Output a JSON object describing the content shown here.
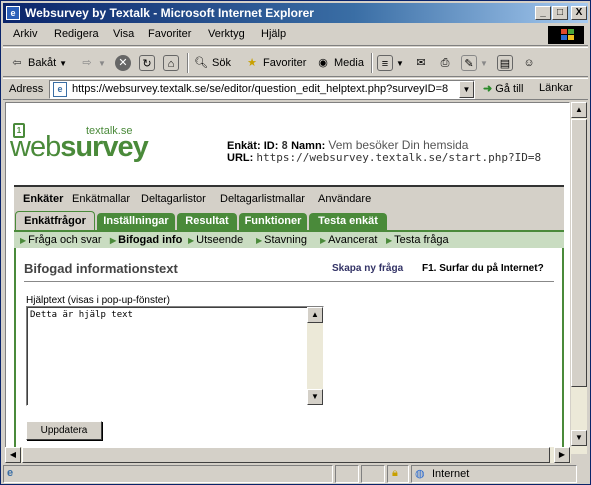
{
  "window": {
    "title": "Websurvey by Textalk - Microsoft Internet Explorer",
    "minimize": "_",
    "maximize": "□",
    "close": "X"
  },
  "menu": [
    "Arkiv",
    "Redigera",
    "Visa",
    "Favoriter",
    "Verktyg",
    "Hjälp"
  ],
  "toolbar": {
    "back": "Bakåt",
    "search": "Sök",
    "favorites": "Favoriter",
    "media": "Media"
  },
  "address": {
    "label": "Adress",
    "url": "https://websurvey.textalk.se/se/editor/question_edit_helptext.php?surveyID=8",
    "go": "Gå till",
    "links": "Länkar"
  },
  "logo": {
    "small": "textalk.se",
    "web": "web",
    "survey": "survey",
    "box": "1"
  },
  "survey_info": {
    "enkat_label": "Enkät:",
    "id_label": "ID:",
    "id": "8",
    "name_label": "Namn:",
    "name": "Vem besöker Din hemsida",
    "url_label": "URL:",
    "url": "https://websurvey.textalk.se/start.php?ID=8"
  },
  "nav": [
    "Enkäter",
    "Enkätmallar",
    "Deltagarlistor",
    "Deltagarlistmallar",
    "Användare"
  ],
  "tabs": [
    "Enkätfrågor",
    "Inställningar",
    "Resultat",
    "Funktioner",
    "Testa enkät"
  ],
  "subnav": [
    "Fråga och svar",
    "Bifogad info",
    "Utseende",
    "Stavning",
    "Avancerat",
    "Testa fråga"
  ],
  "panel": {
    "title": "Bifogad informationstext",
    "new_question": "Skapa ny fråga",
    "question": "F1. Surfar du på Internet?",
    "help_label": "Hjälptext (visas i pop-up-fönster)",
    "help_value": "Detta är hjälp text",
    "update": "Uppdatera"
  },
  "status": {
    "zone": "Internet"
  },
  "colors": {
    "brand_green": "#4a8a3a",
    "titlebar": "#0a246a"
  }
}
